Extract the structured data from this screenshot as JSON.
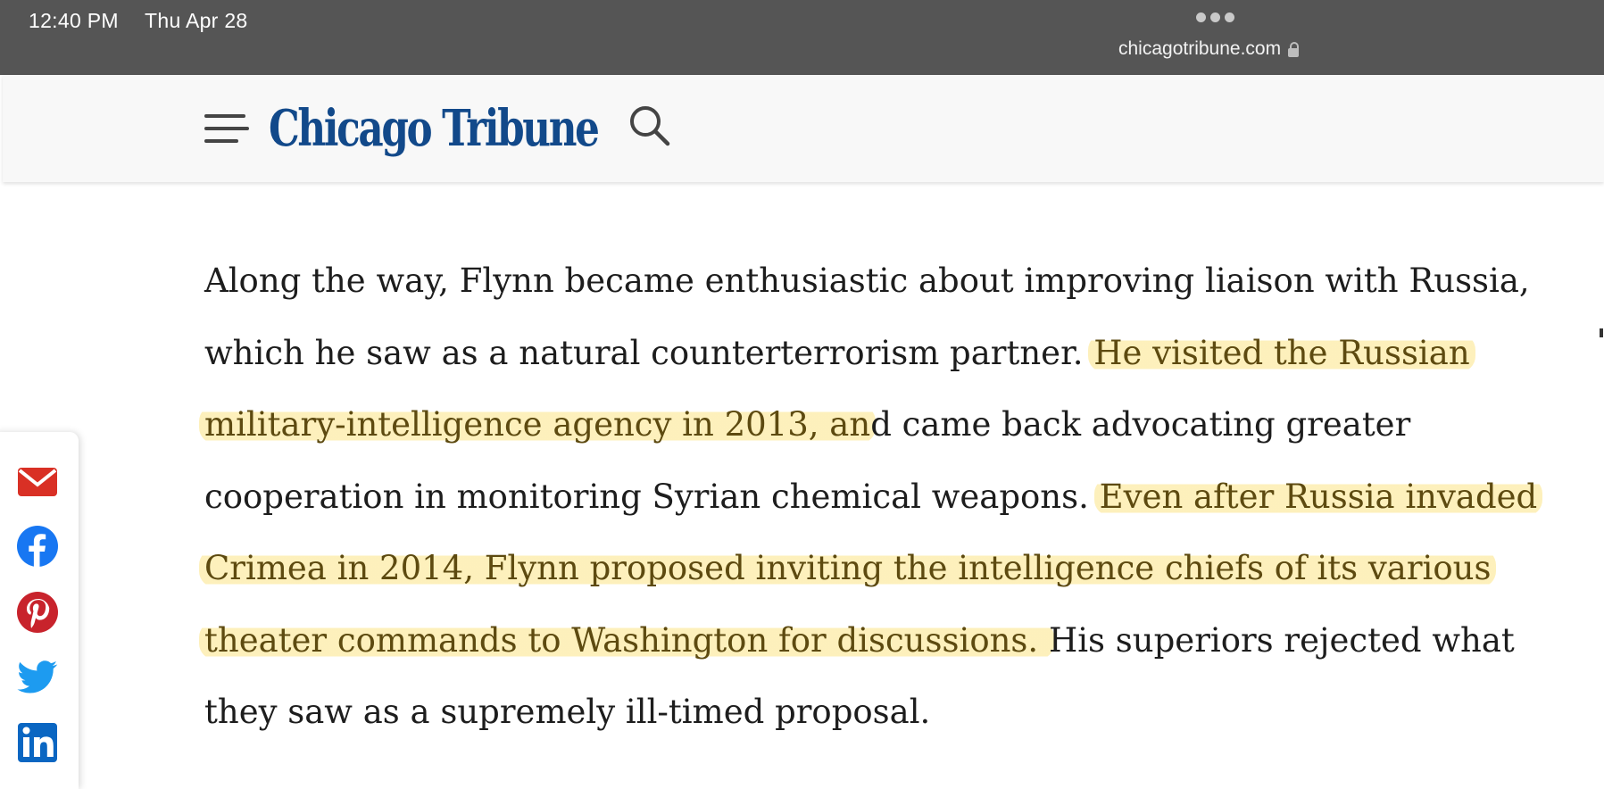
{
  "status_bar": {
    "time": "12:40 PM",
    "date": "Thu Apr 28",
    "url": "chicagotribune.com"
  },
  "header": {
    "logo_text": "Chicago Tribune",
    "logo_color": "#12498a"
  },
  "article": {
    "paragraph": [
      {
        "text": "Along the way, Flynn became enthusiastic about improving liaison with Russia, which he saw as a natural counterterrorism partner. ",
        "highlight": false
      },
      {
        "text": "He visited the Russian military-intelligence agency in 2013, an",
        "highlight": true
      },
      {
        "text": "d came back advocating greater cooperation in monitoring Syrian chemical weapons. ",
        "highlight": false
      },
      {
        "text": "Even after Russia invaded Crimea in 2014, Flynn proposed inviting the intelligence chiefs of its various theater commands to Washington for discussions. ",
        "highlight": true
      },
      {
        "text": "His superiors rejected what they saw as a supremely ill-timed proposal.",
        "highlight": false
      }
    ],
    "highlight_color": "#fdeeb0"
  },
  "share": {
    "icons": [
      "email-icon",
      "facebook-icon",
      "pinterest-icon",
      "twitter-icon",
      "linkedin-icon"
    ],
    "colors": {
      "email": "#d93025",
      "facebook": "#1877f2",
      "pinterest": "#c8232c",
      "twitter": "#1d9bf0",
      "linkedin": "#0a66c2"
    }
  }
}
